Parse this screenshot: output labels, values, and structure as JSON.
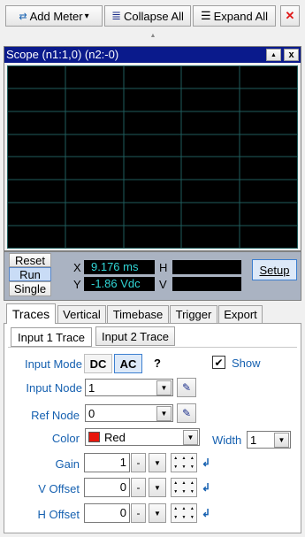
{
  "toolbar": {
    "add_meter": "Add Meter",
    "add_meter_caret": "▾",
    "collapse_all": "Collapse All",
    "expand_all": "Expand All",
    "close_glyph": "✕",
    "collapse_arrow": "▲"
  },
  "scope": {
    "title": "Scope (n1:1,0) (n2:-0)",
    "ctrl_up": "▲",
    "ctrl_close": "x"
  },
  "control": {
    "reset": "Reset",
    "run": "Run",
    "single": "Single",
    "x_label": "X",
    "x_value": "9.176 ms",
    "y_label": "Y",
    "y_value": "-1.86 Vdc",
    "h_label": "H",
    "h_value": "",
    "v_label": "V",
    "v_value": "",
    "setup": "Setup"
  },
  "tabs": [
    "Traces",
    "Vertical",
    "Timebase",
    "Trigger",
    "Export"
  ],
  "subtabs": [
    "Input 1 Trace",
    "Input 2 Trace"
  ],
  "form": {
    "input_mode_label": "Input Mode",
    "mode_dc": "DC",
    "mode_ac": "AC",
    "help": "?",
    "show_label": "Show",
    "show_checked": "✔",
    "input_node_label": "Input Node",
    "input_node_value": "1",
    "ref_node_label": "Ref Node",
    "ref_node_value": "0",
    "color_label": "Color",
    "color_value": "Red",
    "color_swatch": "#e8160c",
    "width_label": "Width",
    "width_value": "1",
    "gain_label": "Gain",
    "gain_value": "1",
    "voffset_label": "V Offset",
    "voffset_value": "0",
    "hoffset_label": "H Offset",
    "hoffset_value": "0",
    "minus": "-",
    "dropdown_glyph": "▼",
    "enter_glyph": "↲"
  },
  "colors": {
    "title_bar": "#0a1a8c",
    "scope_bg": "#000000",
    "grid": "#1f5d5d",
    "readout_bg": "#000000",
    "readout_fg": "#31d6d6",
    "accent": "#1560b0"
  }
}
